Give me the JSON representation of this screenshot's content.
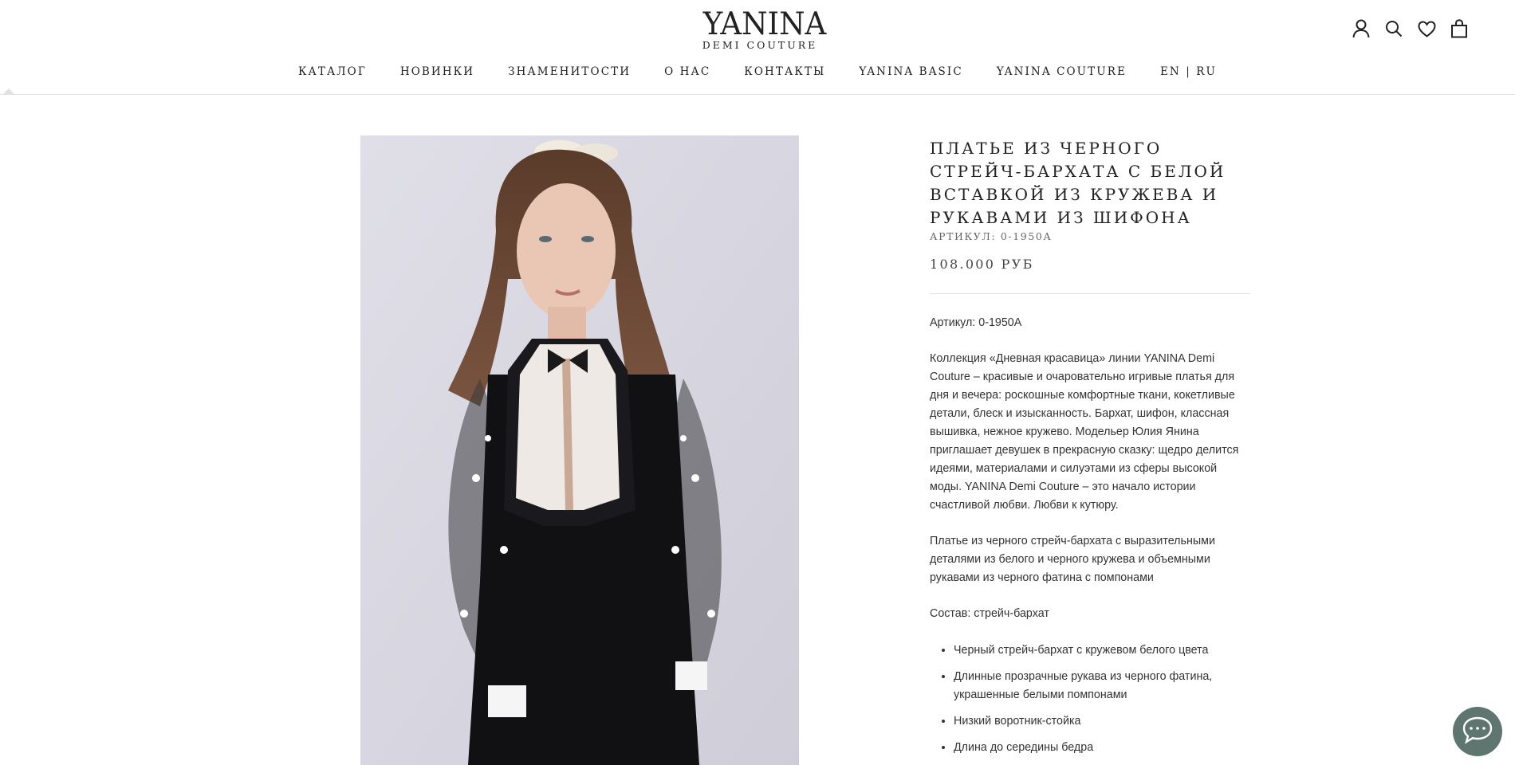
{
  "brand": {
    "logo_main": "YANINA",
    "logo_sub": "DEMI COUTURE"
  },
  "header_icons": [
    "account-icon",
    "search-icon",
    "wishlist-heart-icon",
    "cart-bag-icon"
  ],
  "nav": [
    {
      "label": "КАТАЛОГ"
    },
    {
      "label": "НОВИНКИ"
    },
    {
      "label": "ЗНАМЕНИТОСТИ"
    },
    {
      "label": "О НАС"
    },
    {
      "label": "КОНТАКТЫ"
    },
    {
      "label": "YANINA BASIC"
    },
    {
      "label": "YANINA COUTURE"
    },
    {
      "label": "EN | RU"
    }
  ],
  "product": {
    "title": "ПЛАТЬЕ ИЗ ЧЕРНОГО СТРЕЙЧ-БАРХАТА С БЕЛОЙ ВСТАВКОЙ ИЗ КРУЖЕВА И РУКАВАМИ ИЗ ШИФОНА",
    "sku_line": "АРТИКУЛ: 0-1950А",
    "price": "108.000 РУБ",
    "article": "Артикул: 0-1950А",
    "collection_text": "Коллекция «Дневная красавица» линии YANINA Demi Couture – красивые и очаровательно игривые платья для дня и вечера: роскошные комфортные ткани, кокетливые детали, блеск и изысканность. Бархат, шифон, классная вышивка, нежное кружево. Модельер Юлия Янина приглашает девушек в прекрасную сказку: щедро делится идеями, материалами и силуэтами из сферы высокой моды. YANINA Demi Couture – это начало истории счастливой любви. Любви к кутюру.",
    "dress_text": "Платье из черного стрейч-бархата с выразительными деталями из белого и черного кружева и объемными рукавами из черного фатина с помпонами",
    "composition": "Состав: стрейч-бархат",
    "features": [
      "Черный стрейч-бархат с кружевом белого цвета",
      "Длинные прозрачные рукава из черного фатина, украшенные белыми помпонами",
      "Низкий воротник-стойка",
      "Длина до середины бедра"
    ]
  },
  "chat": {
    "icon": "chat-bubble-icon"
  }
}
